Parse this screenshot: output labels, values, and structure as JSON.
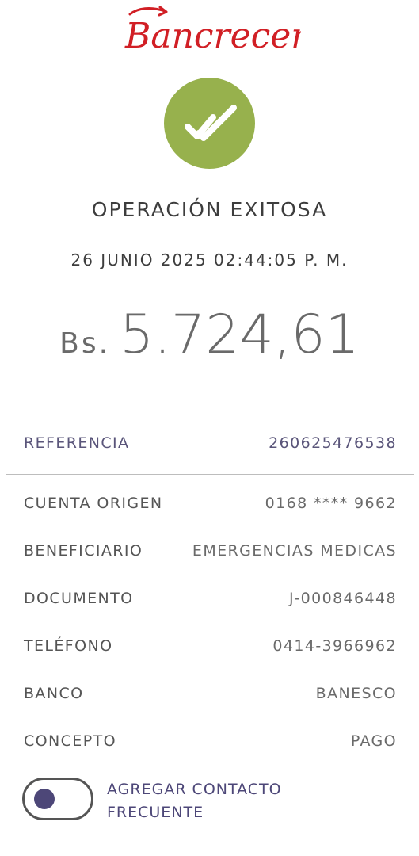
{
  "brand": {
    "name": "Bancrecer",
    "color": "#d11f25"
  },
  "status": {
    "icon": "double-check-icon",
    "icon_color": "#97b14d",
    "title": "OPERACIÓN EXITOSA",
    "datetime": "26 JUNIO 2025 02:44:05 P. M."
  },
  "amount": {
    "currency": "Bs.",
    "value": "5.724,61"
  },
  "reference": {
    "label": "REFERENCIA",
    "value": "260625476538"
  },
  "details": [
    {
      "label": "CUENTA ORIGEN",
      "value": "0168 **** 9662"
    },
    {
      "label": "BENEFICIARIO",
      "value": "EMERGENCIAS MEDICAS"
    },
    {
      "label": "DOCUMENTO",
      "value": "J-000846448"
    },
    {
      "label": "TELÉFONO",
      "value": "0414-3966962"
    },
    {
      "label": "BANCO",
      "value": "BANESCO"
    },
    {
      "label": "CONCEPTO",
      "value": "PAGO"
    }
  ],
  "frequent_contact": {
    "line1": "AGREGAR CONTACTO",
    "line2": "FRECUENTE",
    "enabled": false
  }
}
